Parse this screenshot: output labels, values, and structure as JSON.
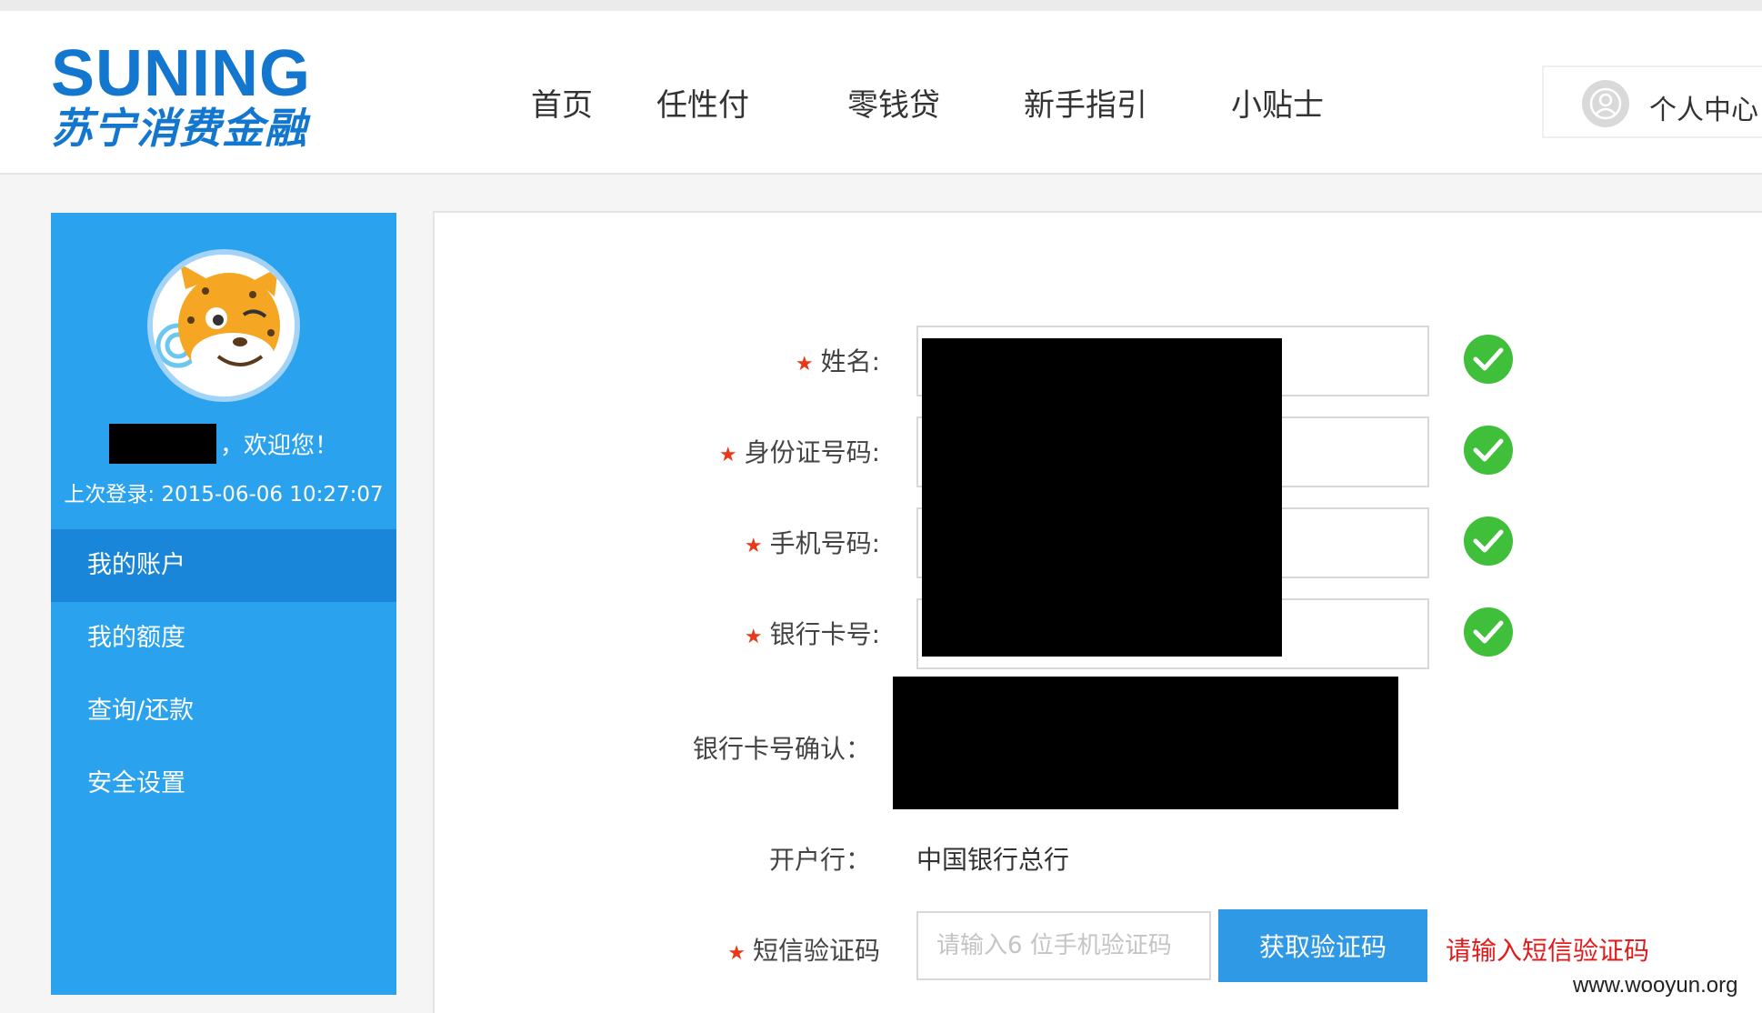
{
  "brand": {
    "logo_en": "SUNING",
    "logo_zh": "苏宁消费金融",
    "logo_color": "#1376cf"
  },
  "nav": {
    "items": [
      "首页",
      "任性付",
      "零钱贷",
      "新手指引",
      "小贴士"
    ],
    "user_center_label": "个人中心"
  },
  "sidebar": {
    "welcome_text": "，欢迎您！",
    "last_login_label": "上次登录:",
    "last_login_time": "2015-06-06 10:27:07",
    "menu": [
      {
        "label": "我的账户",
        "active": true
      },
      {
        "label": "我的额度",
        "active": false
      },
      {
        "label": "查询/还款",
        "active": false
      },
      {
        "label": "安全设置",
        "active": false
      }
    ],
    "bg_color": "#2ba2ee"
  },
  "form": {
    "required_mark": "★",
    "name_label": "姓名:",
    "id_label": "身份证号码:",
    "phone_label": "手机号码:",
    "card_label": "银行卡号:",
    "card_confirm_label": "银行卡号确认：",
    "bank_label": "开户行：",
    "bank_value": "中国银行总行",
    "sms_label": "短信验证码",
    "sms_placeholder": "请输入6 位手机验证码",
    "sms_button": "获取验证码",
    "sms_error": "请输入短信验证码",
    "valid_icon": "check-circle-icon",
    "valid_color": "#3fbf3a",
    "error_color": "#e01b1b"
  },
  "watermark": "www.wooyun.org"
}
